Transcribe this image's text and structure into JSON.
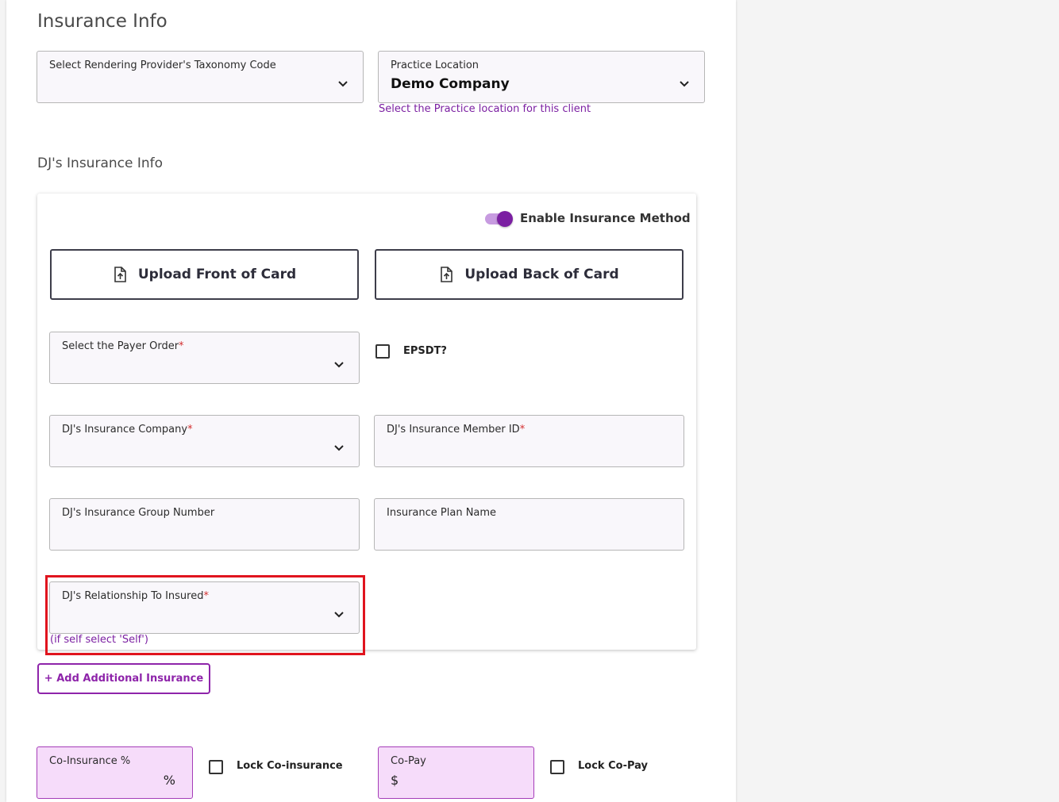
{
  "page": {
    "title": "Insurance Info",
    "section_title": "DJ's Insurance Info"
  },
  "taxonomy": {
    "label": "Select Rendering Provider's Taxonomy Code",
    "value": ""
  },
  "practice_location": {
    "label": "Practice Location",
    "value": "Demo Company",
    "helper": "Select the Practice location for this client"
  },
  "insurance": {
    "toggle_label": "Enable Insurance Method",
    "toggle_on": true,
    "upload_front": "Upload Front of Card",
    "upload_back": "Upload Back of Card",
    "payer_order_label": "Select the Payer Order",
    "epsdt_label": "EPSDT?",
    "company_label": "DJ's Insurance Company",
    "member_id_label": "DJ's Insurance Member ID",
    "group_number_label": "DJ's Insurance Group Number",
    "plan_name_label": "Insurance Plan Name",
    "relationship_label": "DJ's Relationship To Insured",
    "relationship_helper": "(if self select 'Self')",
    "required_mark": "*"
  },
  "add_insurance_label": "+ Add Additional Insurance",
  "billing": {
    "coinsurance_label": "Co-Insurance %",
    "coinsurance_suffix": "%",
    "lock_coinsurance_label": "Lock Co-insurance",
    "copay_label": "Co-Pay",
    "copay_prefix": "$",
    "lock_copay_label": "Lock Co-Pay"
  },
  "colors": {
    "accent": "#7b1fa2",
    "required": "#d32f2f",
    "highlight": "#e0141e",
    "pink_field": "#f6dcfa"
  }
}
